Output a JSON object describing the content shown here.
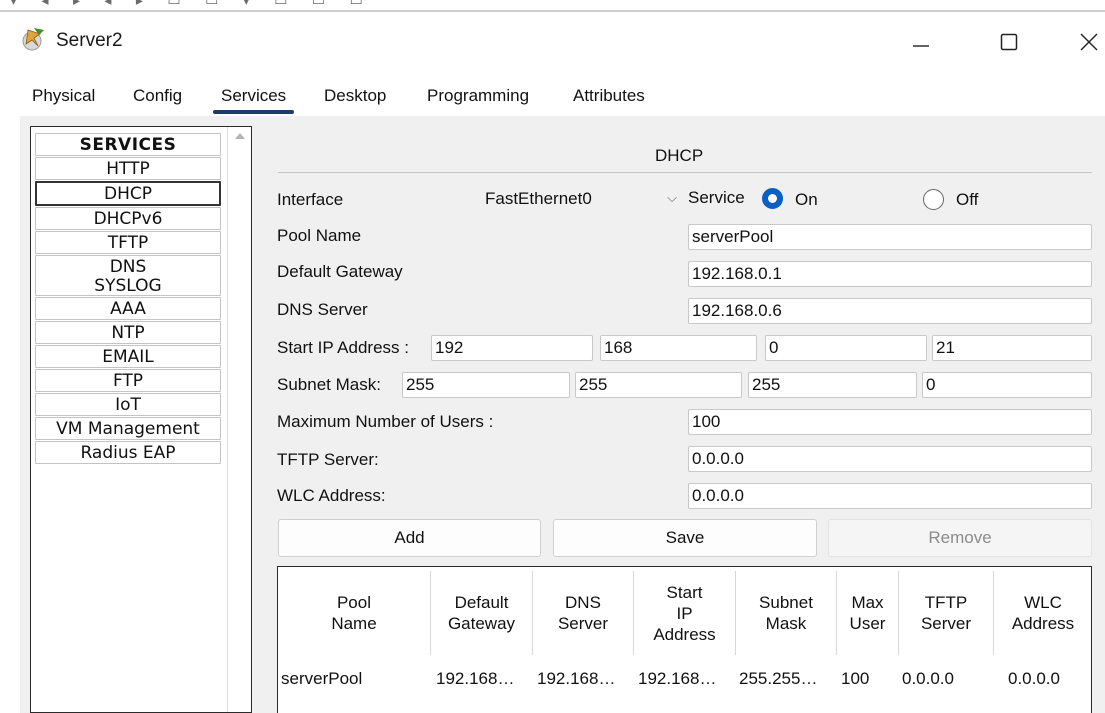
{
  "window": {
    "title": "Server2",
    "controls": {
      "minimize": "minimize",
      "maximize": "maximize",
      "close": "close"
    }
  },
  "tabs": [
    {
      "label": "Physical",
      "active": false
    },
    {
      "label": "Config",
      "active": false
    },
    {
      "label": "Services",
      "active": true
    },
    {
      "label": "Desktop",
      "active": false
    },
    {
      "label": "Programming",
      "active": false
    },
    {
      "label": "Attributes",
      "active": false
    }
  ],
  "services": {
    "header": "SERVICES",
    "items": [
      "HTTP",
      "DHCP",
      "DHCPv6",
      "TFTP",
      "DNS",
      "SYSLOG",
      "AAA",
      "NTP",
      "EMAIL",
      "FTP",
      "IoT",
      "VM Management",
      "Radius EAP"
    ],
    "selected": "DHCP"
  },
  "dhcp": {
    "title": "DHCP",
    "interface_label": "Interface",
    "interface_value": "FastEthernet0",
    "service_label": "Service",
    "on_label": "On",
    "off_label": "Off",
    "service_on": true,
    "pool_name_label": "Pool Name",
    "pool_name": "serverPool",
    "default_gateway_label": "Default Gateway",
    "default_gateway": "192.168.0.1",
    "dns_server_label": "DNS Server",
    "dns_server": "192.168.0.6",
    "start_ip_label": "Start IP Address :",
    "start_ip": [
      "192",
      "168",
      "0",
      "21"
    ],
    "subnet_mask_label": "Subnet Mask:",
    "subnet_mask": [
      "255",
      "255",
      "255",
      "0"
    ],
    "max_users_label": "Maximum Number of Users :",
    "max_users": "100",
    "tftp_server_label": "TFTP Server:",
    "tftp_server": "0.0.0.0",
    "wlc_address_label": "WLC Address:",
    "wlc_address": "0.0.0.0",
    "buttons": {
      "add": "Add",
      "save": "Save",
      "remove": "Remove"
    },
    "table": {
      "headers": [
        [
          "Pool",
          "Name"
        ],
        [
          "Default",
          "Gateway"
        ],
        [
          "DNS",
          "Server"
        ],
        [
          "Start",
          "IP",
          "Address"
        ],
        [
          "Subnet",
          "Mask"
        ],
        [
          "Max",
          "User"
        ],
        [
          "TFTP",
          "Server"
        ],
        [
          "WLC",
          "Address"
        ]
      ],
      "rows": [
        [
          "serverPool",
          "192.168…",
          "192.168…",
          "192.168…",
          "255.255…",
          "100",
          "0.0.0.0",
          "0.0.0.0"
        ]
      ]
    }
  },
  "colors": {
    "accent": "#0a5fc4",
    "tab_underline": "#1b3d6e",
    "panel_bg": "#f0f0f0"
  }
}
